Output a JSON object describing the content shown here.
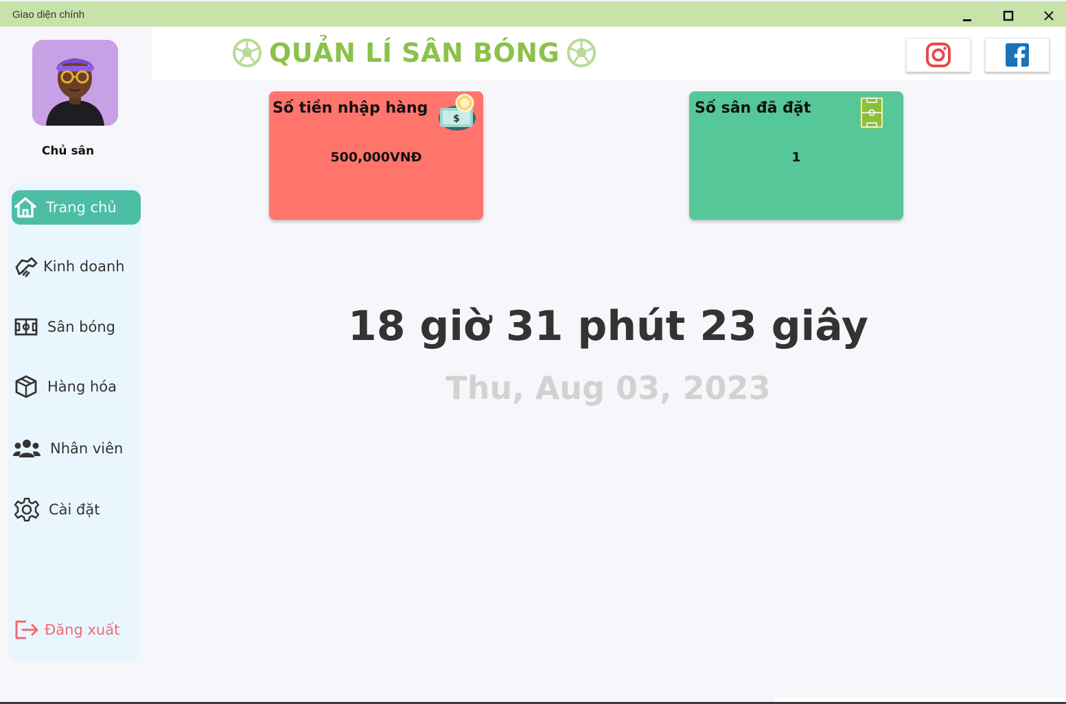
{
  "window": {
    "title": "Giao diện chính",
    "controls": [
      "minimize",
      "maximize",
      "close"
    ]
  },
  "header": {
    "brand_title": "QUẢN LÍ SÂN BÓNG",
    "brand_icon": "soccer-ball-icon",
    "social": [
      "instagram-icon",
      "facebook-icon"
    ],
    "brand_color": "#8cc14a"
  },
  "profile": {
    "role": "Chủ sân"
  },
  "sidebar": {
    "items": [
      {
        "label": "Trang chủ",
        "icon": "home-icon",
        "active": true
      },
      {
        "label": "Kinh doanh",
        "icon": "handshake-icon"
      },
      {
        "label": "Sân bóng",
        "icon": "field-icon"
      },
      {
        "label": "Hàng hóa",
        "icon": "box-icon"
      },
      {
        "label": "Nhân viên",
        "icon": "users-icon"
      },
      {
        "label": "Cài đặt",
        "icon": "gear-icon"
      }
    ],
    "logout": {
      "label": "Đăng xuất",
      "icon": "logout-icon"
    },
    "active_color": "#4dbda6"
  },
  "cards": [
    {
      "title": "Số tiền nhập hàng",
      "value": "500,000VNĐ",
      "icon": "money-icon",
      "color": "#ff756c"
    },
    {
      "title": "Số sân đã đặt",
      "value": "1",
      "icon": "soccer-field-icon",
      "color": "#55c798"
    }
  ],
  "clock": {
    "time": "18 giờ 31 phút 23 giây",
    "date": "Thu, Aug 03, 2023"
  }
}
